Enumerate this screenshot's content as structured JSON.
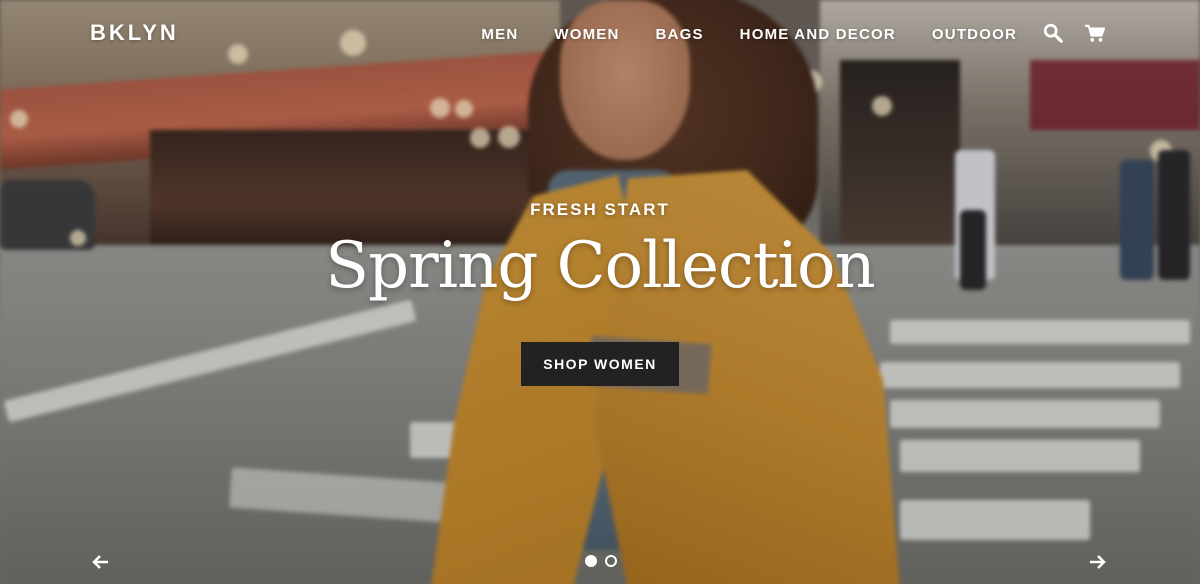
{
  "store": {
    "logo": "BKLYN"
  },
  "nav": {
    "items": [
      {
        "label": "MEN"
      },
      {
        "label": "WOMEN"
      },
      {
        "label": "BAGS"
      },
      {
        "label": "HOME AND DECOR"
      },
      {
        "label": "OUTDOOR"
      }
    ],
    "icons": [
      "search-icon",
      "cart-icon"
    ]
  },
  "hero": {
    "eyebrow": "FRESH START",
    "headline": "Spring Collection",
    "cta_label": "SHOP WOMEN"
  },
  "slideshow": {
    "slide_count": 2,
    "active_slide": 1,
    "prev_icon": "arrow-left-icon",
    "next_icon": "arrow-right-icon"
  },
  "colors": {
    "text": "#ffffff",
    "button_bg": "#222222",
    "jacket": "#c98e31"
  }
}
